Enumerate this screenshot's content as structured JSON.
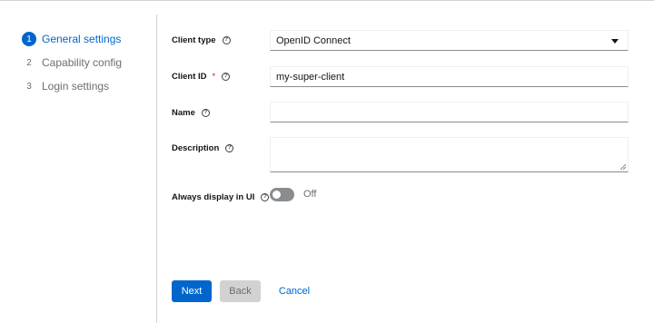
{
  "wizard": {
    "steps": [
      {
        "number": "1",
        "label": "General settings",
        "state": "current"
      },
      {
        "number": "2",
        "label": "Capability config",
        "state": "disabled"
      },
      {
        "number": "3",
        "label": "Login settings",
        "state": "disabled"
      }
    ]
  },
  "form": {
    "client_type": {
      "label": "Client type",
      "help": "?",
      "value": "OpenID Connect"
    },
    "client_id": {
      "label": "Client ID",
      "required_marker": "*",
      "help": "?",
      "value": "my-super-client"
    },
    "name": {
      "label": "Name",
      "help": "?",
      "value": ""
    },
    "description": {
      "label": "Description",
      "help": "?",
      "value": ""
    },
    "always_display": {
      "label": "Always display in UI",
      "help": "?",
      "toggle_state": "Off",
      "enabled": false
    }
  },
  "footer": {
    "next_label": "Next",
    "back_label": "Back",
    "cancel_label": "Cancel"
  },
  "colors": {
    "primary": "#0066cc",
    "required": "#c9190b",
    "toggle_off": "#8a8d90",
    "disabled_button": "#d2d2d2"
  }
}
